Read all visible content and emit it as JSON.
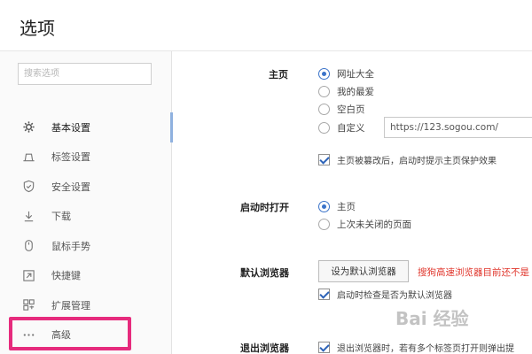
{
  "header": {
    "title": "选项"
  },
  "sidebar": {
    "search_placeholder": "搜索选项",
    "items": [
      {
        "label": "基本设置",
        "icon": "gear-icon",
        "active": true
      },
      {
        "label": "标签设置",
        "icon": "tab-icon",
        "active": false
      },
      {
        "label": "安全设置",
        "icon": "shield-icon",
        "active": false
      },
      {
        "label": "下载",
        "icon": "download-icon",
        "active": false
      },
      {
        "label": "鼠标手势",
        "icon": "mouse-icon",
        "active": false
      },
      {
        "label": "快捷键",
        "icon": "shortcut-icon",
        "active": false
      },
      {
        "label": "扩展管理",
        "icon": "extensions-icon",
        "active": false
      },
      {
        "label": "高级",
        "icon": "ellipsis-icon",
        "active": false
      }
    ],
    "highlight_color": "#e62b7d"
  },
  "homepage": {
    "label": "主页",
    "options": [
      {
        "label": "网址大全",
        "checked": true
      },
      {
        "label": "我的最爱",
        "checked": false
      },
      {
        "label": "空白页",
        "checked": false
      },
      {
        "label": "自定义",
        "checked": false
      }
    ],
    "custom_url": "https://123.sogou.com/",
    "protect_label": "主页被篡改后，启动时提示主页保护效果",
    "protect_checked": true
  },
  "startup": {
    "label": "启动时打开",
    "options": [
      {
        "label": "主页",
        "checked": true
      },
      {
        "label": "上次未关闭的页面",
        "checked": false
      }
    ]
  },
  "default_browser": {
    "label": "默认浏览器",
    "button_label": "设为默认浏览器",
    "warning": "搜狗高速浏览器目前还不是",
    "check_label": "启动时检查是否为默认浏览器",
    "check_checked": true
  },
  "exit_browser": {
    "label": "退出浏览器",
    "check_label": "退出浏览器时，若有多个标签页打开则弹出提",
    "check_checked": true
  },
  "watermark": "Bai 经验"
}
